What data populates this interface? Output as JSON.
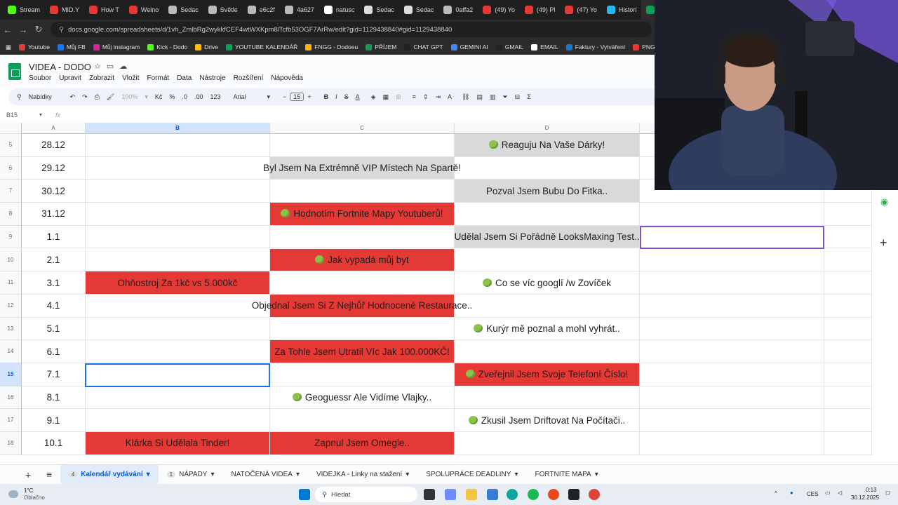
{
  "browser": {
    "tabs": [
      {
        "label": "Stream",
        "color": "#53fc18"
      },
      {
        "label": "MID.Y",
        "color": "#e53935"
      },
      {
        "label": "How T",
        "color": "#e53935"
      },
      {
        "label": "Welno",
        "color": "#e53935"
      },
      {
        "label": "Sedac",
        "color": "#bbbbbb"
      },
      {
        "label": "Světle",
        "color": "#bbbbbb"
      },
      {
        "label": "e6c2f",
        "color": "#bbbbbb"
      },
      {
        "label": "4a627",
        "color": "#bbbbbb"
      },
      {
        "label": "natusc",
        "color": "#ffffff"
      },
      {
        "label": "Sedac",
        "color": "#dddddd"
      },
      {
        "label": "Sedac",
        "color": "#dddddd"
      },
      {
        "label": "0affa2",
        "color": "#bbbbbb"
      },
      {
        "label": "(49) Yo",
        "color": "#e53935"
      },
      {
        "label": "(49) Pl",
        "color": "#e53935"
      },
      {
        "label": "(47) Yo",
        "color": "#e53935"
      },
      {
        "label": "Histori",
        "color": "#29b6f6"
      }
    ],
    "url": "docs.google.com/spreadsheets/d/1vh_ZmlbRg2wykkfCEF4wtWXKpm8lTcfb53OGF7ArRw/edit?gid=1129438840#gid=1129438840",
    "bookmarks": [
      {
        "label": "Youtube",
        "color": "#e53935"
      },
      {
        "label": "Můj FB",
        "color": "#1877f2"
      },
      {
        "label": "Můj instagram",
        "color": "#d6249f"
      },
      {
        "label": "Kick - Dodo",
        "color": "#53fc18"
      },
      {
        "label": "Drive",
        "color": "#fbbc04"
      },
      {
        "label": "YOUTUBE KALENDÁŘ",
        "color": "#0f9d58"
      },
      {
        "label": "FNGG - Dodoeu",
        "color": "#ffb300"
      },
      {
        "label": "PŘÍJEM",
        "color": "#0f9d58"
      },
      {
        "label": "CHAT GPT",
        "color": "#222222"
      },
      {
        "label": "GEMINI AI",
        "color": "#4285f4"
      },
      {
        "label": "GMAIL",
        "color": "#222222"
      },
      {
        "label": "EMAIL",
        "color": "#ffffff"
      },
      {
        "label": "Faktury - Vytváření",
        "color": "#1976d2"
      },
      {
        "label": "PNG",
        "color": "#e53935"
      }
    ]
  },
  "doc": {
    "title": "VIDEA - DODO",
    "menus": [
      "Soubor",
      "Upravit",
      "Zobrazit",
      "Vložit",
      "Formát",
      "Data",
      "Nástroje",
      "Rozšíření",
      "Nápověda"
    ]
  },
  "toolbar": {
    "search": "Nabídky",
    "zoom": "100%",
    "currency": "Kč",
    "percent": "%",
    "dec_minus": ".0",
    "dec_plus": ".00",
    "number": "123",
    "font": "Arial",
    "font_size": "15"
  },
  "formula": {
    "namebox": "B15",
    "fx": "fx"
  },
  "columns": [
    "A",
    "B",
    "C",
    "D"
  ],
  "rows": [
    {
      "num": "5",
      "a": "28.12",
      "b": "",
      "c": "",
      "d": "Reaguju Na Vaše Dárky!",
      "d_apple": true
    },
    {
      "num": "6",
      "a": "29.12",
      "b": "",
      "c": "Byl Jsem Na Extrémně VIP Místech Na Spartě!",
      "d": ""
    },
    {
      "num": "7",
      "a": "30.12",
      "b": "",
      "c": "",
      "d": "Pozval Jsem Bubu Do Fitka.."
    },
    {
      "num": "8",
      "a": "31.12",
      "b": "",
      "c": "Hodnotím Fortnite Mapy Youtuberů!",
      "c_apple": true,
      "d": ""
    },
    {
      "num": "9",
      "a": "1.1",
      "b": "",
      "c": "",
      "d": "Udělal Jsem Si Pořádně LooksMaxing Test.."
    },
    {
      "num": "10",
      "a": "2.1",
      "b": "",
      "c": "Jak vypadá můj byt",
      "c_apple": true,
      "d": ""
    },
    {
      "num": "11",
      "a": "3.1",
      "b": "Ohňostroj Za 1kč vs 5.000kč",
      "c": "",
      "d": "Co se víc googlí /w Zovíček",
      "d_apple": true
    },
    {
      "num": "12",
      "a": "4.1",
      "b": "",
      "c": "Objednal Jsem Si Z Nejhůř Hodnocené Restaurace..",
      "d": ""
    },
    {
      "num": "13",
      "a": "5.1",
      "b": "",
      "c": "",
      "d": "Kurýr mě poznal a mohl vyhrát..",
      "d_apple": true
    },
    {
      "num": "14",
      "a": "6.1",
      "b": "",
      "c": "Za Tohle Jsem Utratil Víc Jak 100.000KČ!",
      "d": ""
    },
    {
      "num": "15",
      "a": "7.1",
      "b": "",
      "c": "",
      "d": "Zveřejnil Jsem Svoje Telefoní Číslo!",
      "d_apple": true
    },
    {
      "num": "16",
      "a": "8.1",
      "b": "",
      "c": "Geoguessr Ale Vidíme Vlajky..",
      "c_apple": true,
      "d": ""
    },
    {
      "num": "17",
      "a": "9.1",
      "b": "",
      "c": "",
      "d": "Zkusil Jsem Driftovat Na Počítači..",
      "d_apple": true
    },
    {
      "num": "18",
      "a": "10.1",
      "b": "Klárka Si Udělala Tinder!",
      "c": "Zapnul Jsem Omegle..",
      "d": ""
    }
  ],
  "sheet_tabs": [
    {
      "badge": "4",
      "label": "Kalendář vydávání"
    },
    {
      "badge": "1",
      "label": "NÁPADY"
    },
    {
      "badge": "",
      "label": "NATOČENÁ VIDEA"
    },
    {
      "badge": "",
      "label": "VIDEJKA - Linky na stažení"
    },
    {
      "badge": "",
      "label": "SPOLUPRÁCE DEADLINY"
    },
    {
      "badge": "",
      "label": "FORTNITE MAPA"
    }
  ],
  "taskbar": {
    "weather_temp": "1°C",
    "weather_desc": "Oblačno",
    "search": "Hledat",
    "lang": "CES",
    "time": "0:13",
    "date": "30.12.2025"
  },
  "colors": {
    "red_cell": "#e53935",
    "grey_cell": "#d9d9d9",
    "selection": "#1a73e8"
  }
}
